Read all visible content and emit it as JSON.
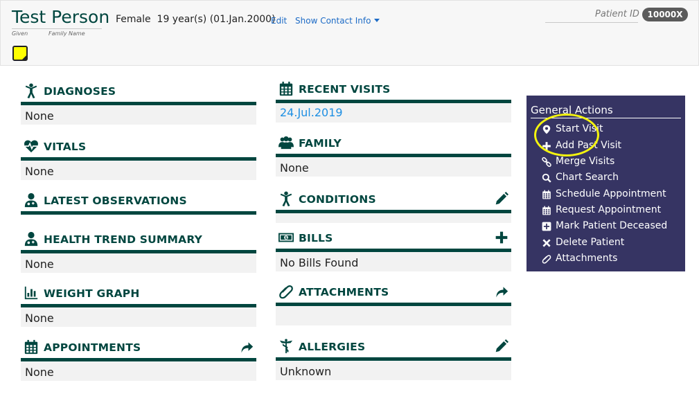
{
  "patient": {
    "name": "Test Person",
    "given_label": "Given",
    "family_label": "Family Name",
    "gender": "Female",
    "age_dob": "19 year(s) (01.Jan.2000)",
    "edit_link": "Edit",
    "contact_link": "Show Contact Info",
    "id_label": "Patient ID",
    "id_value": "10000X"
  },
  "sections": {
    "diagnoses": {
      "title": "DIAGNOSES",
      "body": "None",
      "icon": "stick-figure-icon"
    },
    "vitals": {
      "title": "VITALS",
      "body": "None",
      "icon": "heartbeat-icon"
    },
    "latest_observations": {
      "title": "LATEST OBSERVATIONS",
      "body": "",
      "icon": "user-md-icon"
    },
    "health_trend_summary": {
      "title": "HEALTH TREND SUMMARY",
      "body": "None",
      "icon": "user-md-icon"
    },
    "weight_graph": {
      "title": "WEIGHT GRAPH",
      "body": "None",
      "icon": "bar-chart-icon"
    },
    "appointments": {
      "title": "APPOINTMENTS",
      "body": "None",
      "icon": "calendar-icon",
      "action": "share-arrow-icon"
    },
    "recent_visits": {
      "title": "RECENT VISITS",
      "body": "24.Jul.2019",
      "icon": "calendar-icon"
    },
    "family": {
      "title": "FAMILY",
      "body": "None",
      "icon": "users-icon"
    },
    "conditions": {
      "title": "CONDITIONS",
      "body": "",
      "icon": "stick-figure-icon",
      "action": "pencil-icon"
    },
    "bills": {
      "title": "BILLS",
      "body": "No Bills Found",
      "icon": "money-icon",
      "action": "plus-icon"
    },
    "attachments": {
      "title": "ATTACHMENTS",
      "body": "",
      "icon": "paperclip-icon",
      "action": "share-arrow-icon"
    },
    "allergies": {
      "title": "ALLERGIES",
      "body": "Unknown",
      "icon": "caduceus-icon",
      "action": "pencil-icon"
    }
  },
  "general_actions": {
    "title": "General Actions",
    "items": [
      {
        "label": "Start Visit",
        "icon": "map-marker-icon"
      },
      {
        "label": "Add Past Visit",
        "icon": "plus-icon"
      },
      {
        "label": "Merge Visits",
        "icon": "link-icon"
      },
      {
        "label": "Chart Search",
        "icon": "search-icon"
      },
      {
        "label": "Schedule Appointment",
        "icon": "calendar-icon"
      },
      {
        "label": "Request Appointment",
        "icon": "calendar-icon"
      },
      {
        "label": "Mark Patient Deceased",
        "icon": "plus-square-icon"
      },
      {
        "label": "Delete Patient",
        "icon": "close-icon"
      },
      {
        "label": "Attachments",
        "icon": "paperclip-icon"
      }
    ]
  },
  "colors": {
    "primary": "#00463f",
    "actions_bg": "#363463",
    "link": "#1d8fe3",
    "highlight": "#f3f30f",
    "sticky_note": "#ffff00"
  }
}
